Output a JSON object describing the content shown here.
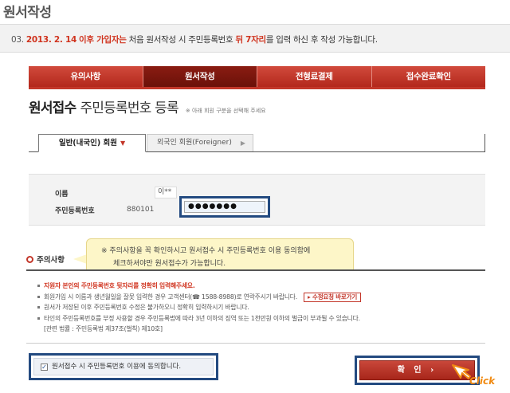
{
  "page": {
    "title": "원서작성"
  },
  "notice": {
    "number": "03.",
    "date": "2013. 2. 14",
    "after": "이후 가입자는",
    "middle": "처음 원서작성 시 주민등록번호",
    "highlight": "뒤 7자리",
    "end": "를 입력 하신 후 작성 가능합니다."
  },
  "steps": [
    "유의사항",
    "원서작성",
    "전형료결제",
    "접수완료확인"
  ],
  "active_step": "원서작성",
  "heading": {
    "main": "원서접수",
    "sub": "주민등록번호 등록",
    "hint": "※ 아래 회원 구분을 선택해 주세요"
  },
  "tabs": {
    "domestic": "일반(내국인) 회원",
    "foreign": "외국인 회원(Foreigner)"
  },
  "form": {
    "name_label": "이름",
    "name_value": "이**",
    "ssn_label": "주민등록번호",
    "ssn_front": "880101",
    "ssn_back_masked": "●●●●●●●"
  },
  "caution": {
    "title": "주의사항",
    "tooltip_line1": "※ 주의사항을 꼭 확인하시고 원서접수 시 주민등록번호 이용 동의함에",
    "tooltip_line2": "체크하셔야만 원서접수가 가능합니다.",
    "items": [
      "지원자 본인의 주민등록번호 뒷자리를 정확히 입력해주세요.",
      "회원가입 시 이름과 생년월일을 잘못 입력한 경우 고객센터(☎ 1588-8988)로 연락주시기 바랍니다.",
      "원서가 저장된 이후 주민등록번호 수정은 불가하오니 정확히 입력하시기 바랍니다.",
      "타인의 주민등록번호를 부정 사용할 경우 주민등록법에 따라 3년 이하의 징역 또는 1천만원 이하의 벌금이 부과될 수 있습니다.",
      "[관련 법률 : 주민등록법 제37조(벌칙) 제10호]"
    ],
    "fix_link": "▸ 수정요청 바로가기"
  },
  "agree_label": "원서접수 시 주민등록번호 이용에 동의합니다.",
  "confirm_label": "확 인  ›",
  "click_label": "Click",
  "colors": {
    "accent": "#c3372a",
    "highlight": "#234a80",
    "tooltip": "#fdf6c8"
  }
}
